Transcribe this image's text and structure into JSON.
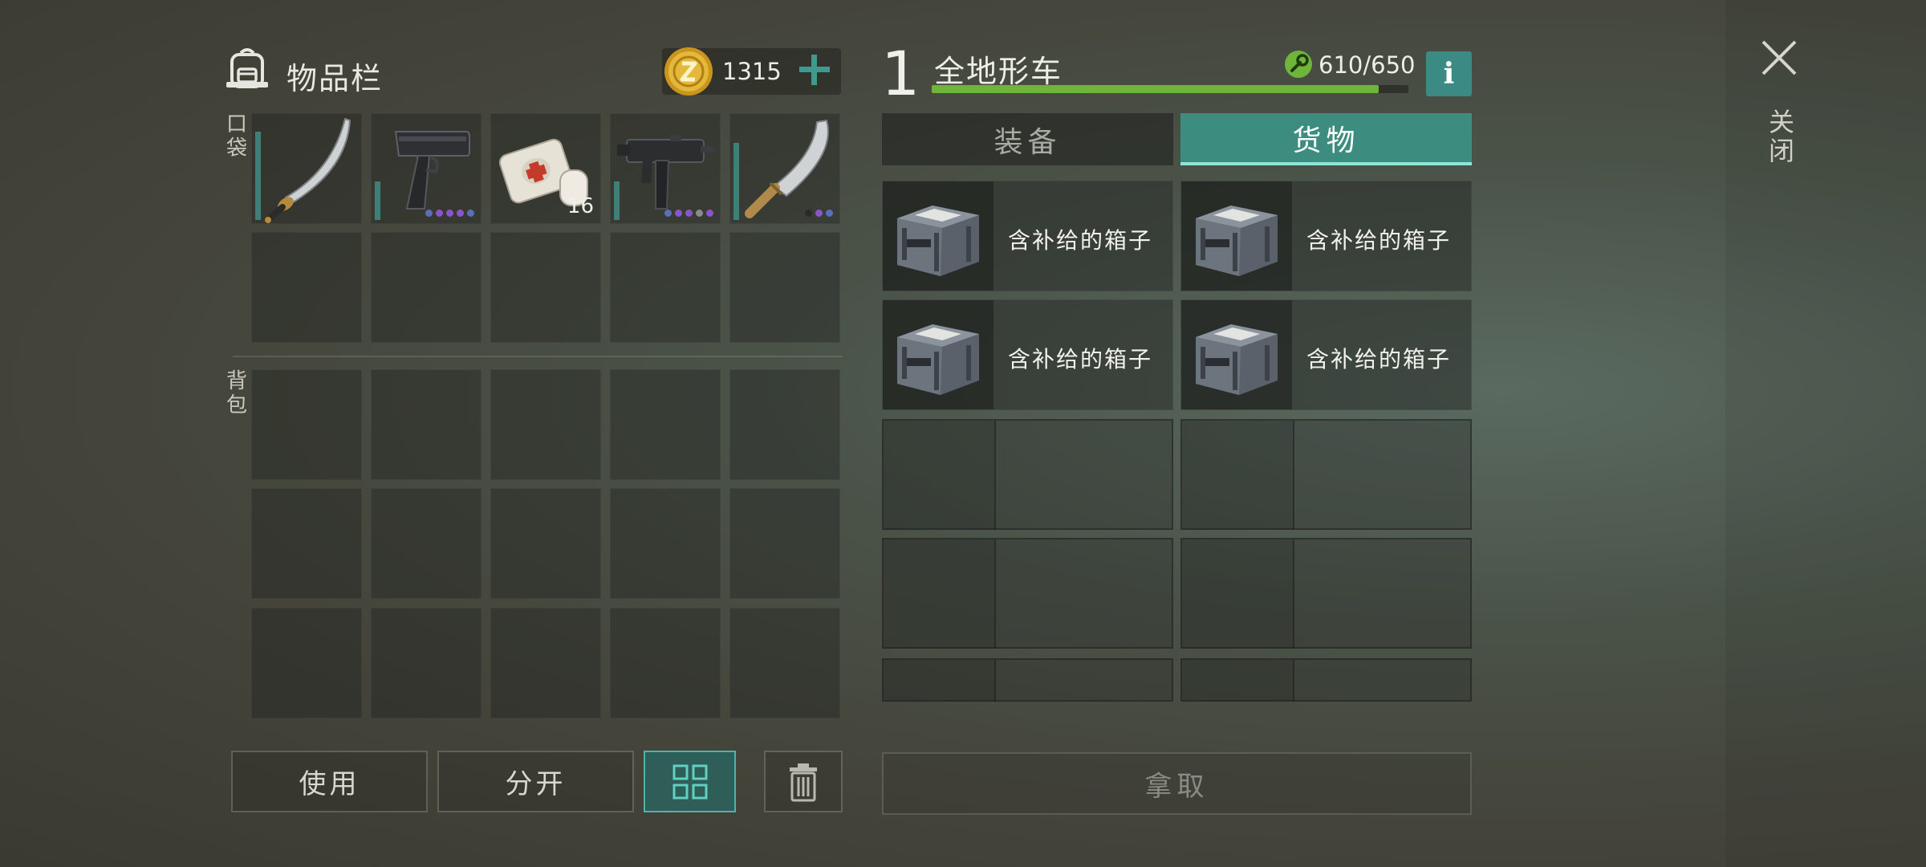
{
  "inventory": {
    "title": "物品栏",
    "coins": "1315",
    "pocket_label": "口袋",
    "backpack_label": "背包",
    "pocket_items": [
      {
        "icon": "katana-icon",
        "durability": 0.8,
        "dots": []
      },
      {
        "icon": "pistol-icon",
        "durability": 0.35,
        "dots": [
          "#5b6fb8",
          "#8a55c9",
          "#8a55c9",
          "#8a55c9",
          "#5b6fb8"
        ]
      },
      {
        "icon": "bandage-icon",
        "count": "16",
        "dots": []
      },
      {
        "icon": "uzi-icon",
        "durability": 0.35,
        "dots": [
          "#5b6fb8",
          "#8a55c9",
          "#8a55c9",
          "#8a8a8a",
          "#8a55c9"
        ]
      },
      {
        "icon": "machete-icon",
        "durability": 0.7,
        "dots": [
          "#2a2a2a",
          "#8a55c9",
          "#5b6fb8"
        ]
      }
    ]
  },
  "buttons": {
    "use": "使用",
    "split": "分开",
    "take": "拿取"
  },
  "vehicle": {
    "level": "1",
    "name": "全地形车",
    "durability": "610/650",
    "durability_fraction": 0.938,
    "info_label": "i",
    "tabs": {
      "equipment": "装备",
      "cargo": "货物"
    },
    "cargo_items": [
      {
        "label": "含补给的箱子",
        "icon": "supply-crate-icon"
      },
      {
        "label": "含补给的箱子",
        "icon": "supply-crate-icon"
      },
      {
        "label": "含补给的箱子",
        "icon": "supply-crate-icon"
      },
      {
        "label": "含补给的箱子",
        "icon": "supply-crate-icon"
      }
    ]
  },
  "close_label": "关闭",
  "colors": {
    "accent": "#3d8c80",
    "durability_bar": "#6fb53a",
    "coin": "#d9a82b"
  }
}
